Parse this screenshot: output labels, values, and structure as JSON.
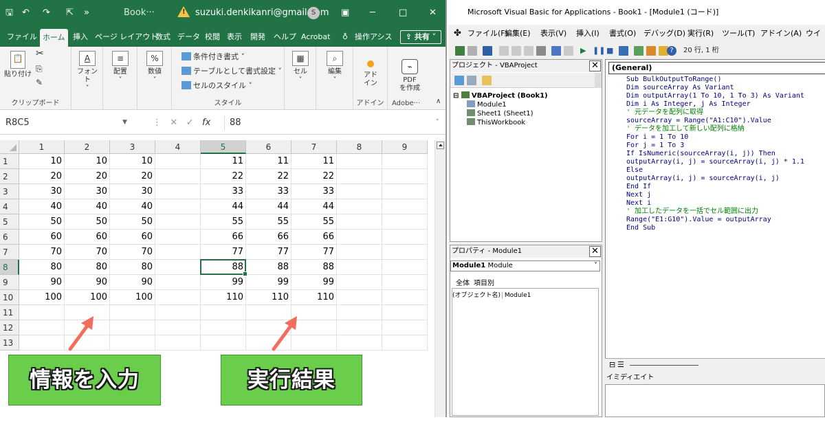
{
  "excel": {
    "title_book": "Book···",
    "account_email": "suzuki.denkikanri@gmail.com",
    "account_initial": "S",
    "warning_glyph": "!",
    "tabs": [
      "ファイル",
      "ホーム",
      "挿入",
      "ページ レイアウト",
      "数式",
      "データ",
      "校閲",
      "表示",
      "開発",
      "ヘルプ",
      "Acrobat",
      "操作アシス"
    ],
    "share_label": "共有",
    "ribbon": {
      "paste": "貼り付け",
      "clipboard": "クリップボード",
      "font": "フォント",
      "alignment": "配置",
      "number": "数値",
      "cond_format": "条件付き書式",
      "table_format": "テーブルとして書式設定",
      "cell_style": "セルのスタイル",
      "styles": "スタイル",
      "cells": "セル",
      "editing": "編集",
      "addins_btn": "アド\nイン",
      "addins": "アドイン",
      "pdf_btn": "PDF\nを作成",
      "adobe": "Adobe···"
    },
    "name_box": "R8C5",
    "formula_value": "88",
    "fx_label": "fx",
    "columns": [
      "1",
      "2",
      "3",
      "4",
      "5",
      "6",
      "7",
      "8",
      "9"
    ],
    "rows": [
      "1",
      "2",
      "3",
      "4",
      "5",
      "6",
      "7",
      "8",
      "9",
      "10",
      "11",
      "12",
      "13"
    ],
    "active_cell": {
      "row": 8,
      "col": 5
    },
    "cells": [
      [
        "10",
        "10",
        "10",
        "",
        "11",
        "11",
        "11",
        "",
        ""
      ],
      [
        "20",
        "20",
        "20",
        "",
        "22",
        "22",
        "22",
        "",
        ""
      ],
      [
        "30",
        "30",
        "30",
        "",
        "33",
        "33",
        "33",
        "",
        ""
      ],
      [
        "40",
        "40",
        "40",
        "",
        "44",
        "44",
        "44",
        "",
        ""
      ],
      [
        "50",
        "50",
        "50",
        "",
        "55",
        "55",
        "55",
        "",
        ""
      ],
      [
        "60",
        "60",
        "60",
        "",
        "66",
        "66",
        "66",
        "",
        ""
      ],
      [
        "70",
        "70",
        "70",
        "",
        "77",
        "77",
        "77",
        "",
        ""
      ],
      [
        "80",
        "80",
        "80",
        "",
        "88",
        "88",
        "88",
        "",
        ""
      ],
      [
        "90",
        "90",
        "90",
        "",
        "99",
        "99",
        "99",
        "",
        ""
      ],
      [
        "100",
        "100",
        "100",
        "",
        "110",
        "110",
        "110",
        "",
        ""
      ]
    ]
  },
  "callouts": {
    "input_label": "情報を入力",
    "result_label": "実行結果",
    "color": "#6acd4c"
  },
  "vba": {
    "window_title": "Microsoft Visual Basic for Applications - Book1 - [Module1 (コード)]",
    "menu": [
      "ファイル(F)",
      "編集(E)",
      "表示(V)",
      "挿入(I)",
      "書式(O)",
      "デバッグ(D)",
      "実行(R)",
      "ツール(T)",
      "アドイン(A)",
      "ウイ"
    ],
    "cursor_pos": "20 行, 1 桁",
    "project_title": "プロジェクト - VBAProject",
    "project_tree": {
      "root": "VBAProject (Book1)",
      "module": "Module1",
      "sheet": "Sheet1 (Sheet1)",
      "workbook": "ThisWorkbook"
    },
    "props_title": "プロパティ - Module1",
    "props_combo_bold": "Module1",
    "props_combo_type": "Module",
    "props_tabs": [
      "全体",
      "項目別"
    ],
    "props_row_name": "(オブジェクト名)",
    "props_row_value": "Module1",
    "code_combo": "(General)",
    "code_lines": [
      "Sub BulkOutputToRange()",
      "Dim sourceArray As Variant",
      "Dim outputArray(1 To 10, 1 To 3) As Variant",
      "Dim i As Integer, j As Integer",
      "' 元データを配列に取得",
      "sourceArray = Range(\"A1:C10\").Value",
      "' データを加工して新しい配列に格納",
      "For i = 1 To 10",
      "For j = 1 To 3",
      "If IsNumeric(sourceArray(i, j)) Then",
      "outputArray(i, j) = sourceArray(i, j) * 1.1",
      "Else",
      "outputArray(i, j) = sourceArray(i, j)",
      "End If",
      "Next j",
      "Next i",
      "' 加工したデータを一括でセル範囲に出力",
      "Range(\"E1:G10\").Value = outputArray",
      "End Sub"
    ],
    "immediate_title": "イミディエイト"
  }
}
